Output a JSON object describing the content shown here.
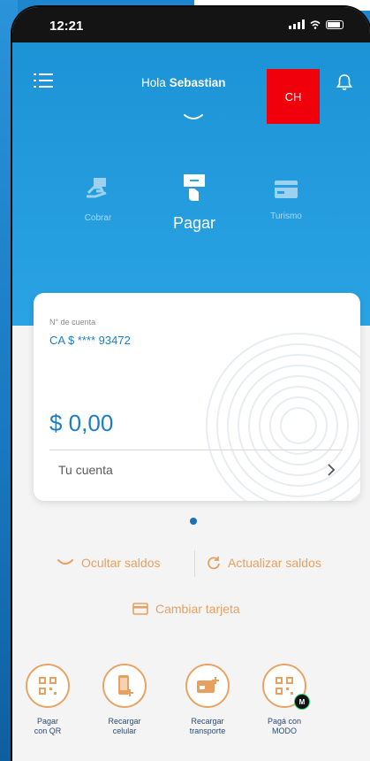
{
  "status_bar": {
    "time": "12:21"
  },
  "header": {
    "greeting_prefix": "Hola",
    "user_name": "Sebastian",
    "avatar_initials": "CH"
  },
  "actions": {
    "cobrar": "Cobrar",
    "pagar": "Pagar",
    "turismo": "Turismo"
  },
  "account_card": {
    "account_label": "N° de cuenta",
    "account_number": "CA $ **** 93472",
    "balance": "$ 0,00",
    "link_label": "Tu cuenta"
  },
  "links": {
    "hide_balances": "Ocultar saldos",
    "refresh_balances": "Actualizar saldos",
    "change_card": "Cambiar tarjeta"
  },
  "quick_actions": [
    {
      "line1": "Pagar",
      "line2": "con QR"
    },
    {
      "line1": "Recargar",
      "line2": "celular"
    },
    {
      "line1": "Recargar",
      "line2": "transporte"
    },
    {
      "line1": "Pagá con",
      "line2": "MODO"
    }
  ],
  "modo_badge": "M",
  "colors": {
    "brand_blue": "#1c93d6",
    "accent_orange": "#e8a060",
    "text_blue": "#1b7ec8",
    "red_badge": "#f0000a"
  }
}
